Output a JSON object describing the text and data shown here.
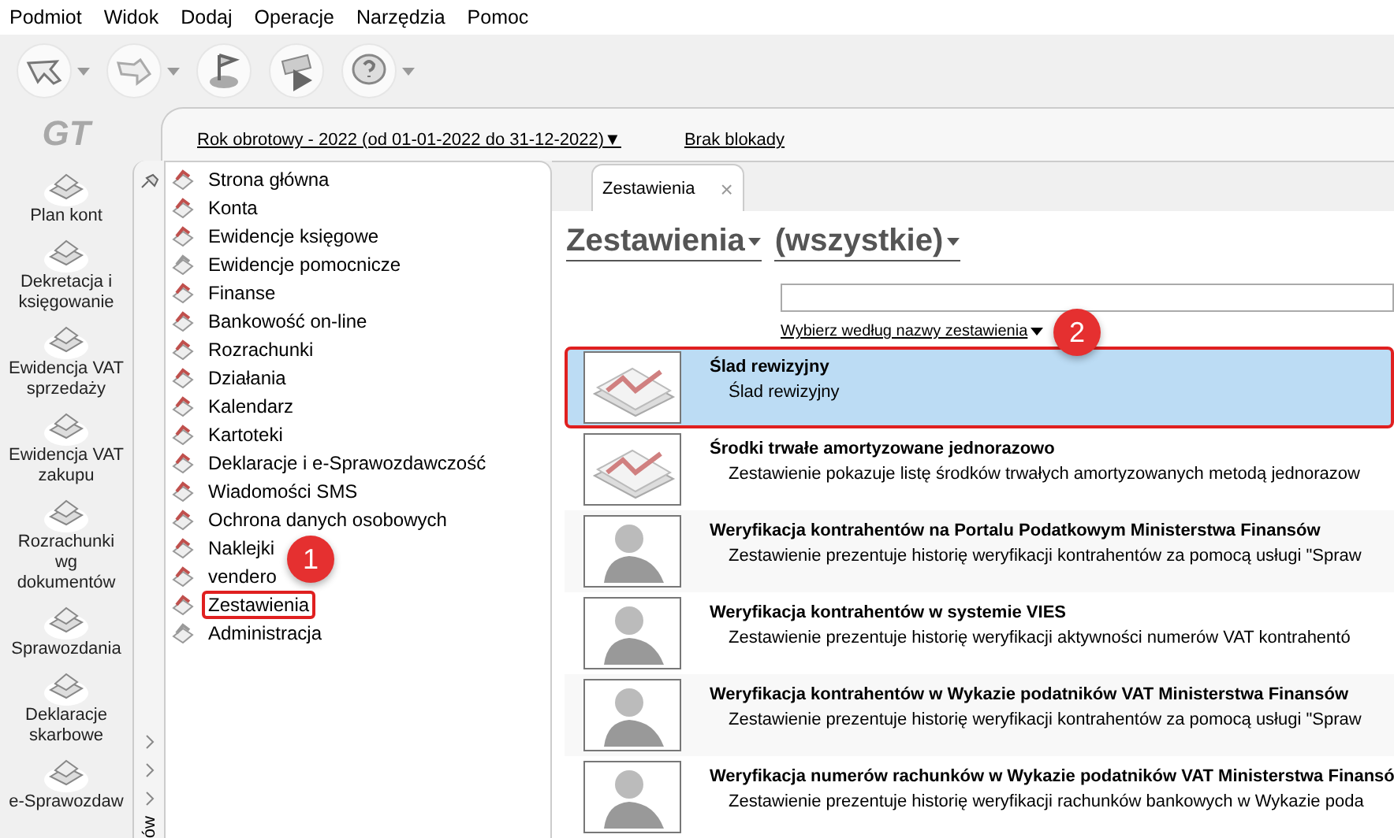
{
  "menu": [
    "Podmiot",
    "Widok",
    "Dodaj",
    "Operacje",
    "Narzędzia",
    "Pomoc"
  ],
  "toolbar": [
    {
      "kind": "back",
      "caret": true
    },
    {
      "kind": "forward",
      "caret": true
    },
    {
      "kind": "flag",
      "caret": false
    },
    {
      "kind": "play",
      "caret": false
    },
    {
      "kind": "help",
      "caret": true
    }
  ],
  "logo": "GT",
  "shortcuts": [
    "Plan kont",
    "Dekretacja i księgowanie",
    "Ewidencja VAT sprzedaży",
    "Ewidencja VAT zakupu",
    "Rozrachunki wg dokumentów",
    "Sprawozdania",
    "Deklaracje skarbowe",
    "e-Sprawozdaw"
  ],
  "header": {
    "fiscal_year": "Rok obrotowy - 2022  (od 01-01-2022 do 31-12-2022)▼",
    "lock": "Brak blokady"
  },
  "side_strip": {
    "label": "ów"
  },
  "tree": [
    {
      "label": "Strona główna",
      "color": "#c0504d",
      "marked": false
    },
    {
      "label": "Konta",
      "color": "#c0504d",
      "marked": false
    },
    {
      "label": "Ewidencje księgowe",
      "color": "#c0504d",
      "marked": false
    },
    {
      "label": "Ewidencje pomocnicze",
      "color": "#9a9a9a",
      "marked": false
    },
    {
      "label": "Finanse",
      "color": "#c0504d",
      "marked": false
    },
    {
      "label": "Bankowość on-line",
      "color": "#c0504d",
      "marked": false
    },
    {
      "label": "Rozrachunki",
      "color": "#c0504d",
      "marked": false
    },
    {
      "label": "Działania",
      "color": "#c0504d",
      "marked": false
    },
    {
      "label": "Kalendarz",
      "color": "#c0504d",
      "marked": false
    },
    {
      "label": "Kartoteki",
      "color": "#c0504d",
      "marked": false
    },
    {
      "label": "Deklaracje i e-Sprawozdawczość",
      "color": "#c0504d",
      "marked": false
    },
    {
      "label": "Wiadomości SMS",
      "color": "#c0504d",
      "marked": false
    },
    {
      "label": "Ochrona danych osobowych",
      "color": "#c0504d",
      "marked": false
    },
    {
      "label": "Naklejki",
      "color": "#c0504d",
      "marked": false
    },
    {
      "label": "vendero",
      "color": "#c0504d",
      "marked": false
    },
    {
      "label": "Zestawienia",
      "color": "#c0504d",
      "marked": true
    },
    {
      "label": "Administracja",
      "color": "#9a9a9a",
      "marked": false
    }
  ],
  "tab": {
    "label": "Zestawienia",
    "close": "×"
  },
  "filters": [
    "Zestawienia",
    "(wszystkie)"
  ],
  "search": {
    "hint": "Wybierz według nazwy zestawienia"
  },
  "reports": [
    {
      "kind": "chart",
      "title": "Ślad rewizyjny",
      "description": "Ślad rewizyjny",
      "selected": true,
      "marked": true
    },
    {
      "kind": "chart",
      "title": "Środki trwałe amortyzowane jednorazowo",
      "description": "Zestawienie pokazuje listę środków trwałych amortyzowanych metodą jednorazow",
      "selected": false,
      "marked": false
    },
    {
      "kind": "person",
      "title": "Weryfikacja kontrahentów na Portalu Podatkowym Ministerstwa Finansów",
      "description": "Zestawienie prezentuje historię weryfikacji kontrahentów za pomocą usługi \"Spraw",
      "selected": false,
      "marked": false
    },
    {
      "kind": "person",
      "title": "Weryfikacja kontrahentów w systemie VIES",
      "description": "Zestawienie prezentuje historię weryfikacji aktywności numerów VAT kontrahentó",
      "selected": false,
      "marked": false
    },
    {
      "kind": "person",
      "title": "Weryfikacja kontrahentów w Wykazie podatników VAT Ministerstwa Finansów",
      "description": "Zestawienie prezentuje historię weryfikacji kontrahentów za pomocą usługi \"Spraw",
      "selected": false,
      "marked": false
    },
    {
      "kind": "person",
      "title": "Weryfikacja numerów rachunków w Wykazie podatników VAT Ministerstwa Finansó",
      "description": "Zestawienie prezentuje historię weryfikacji rachunków bankowych w Wykazie poda",
      "selected": false,
      "marked": false
    }
  ],
  "annotations": [
    {
      "label": "1"
    },
    {
      "label": "2"
    }
  ]
}
